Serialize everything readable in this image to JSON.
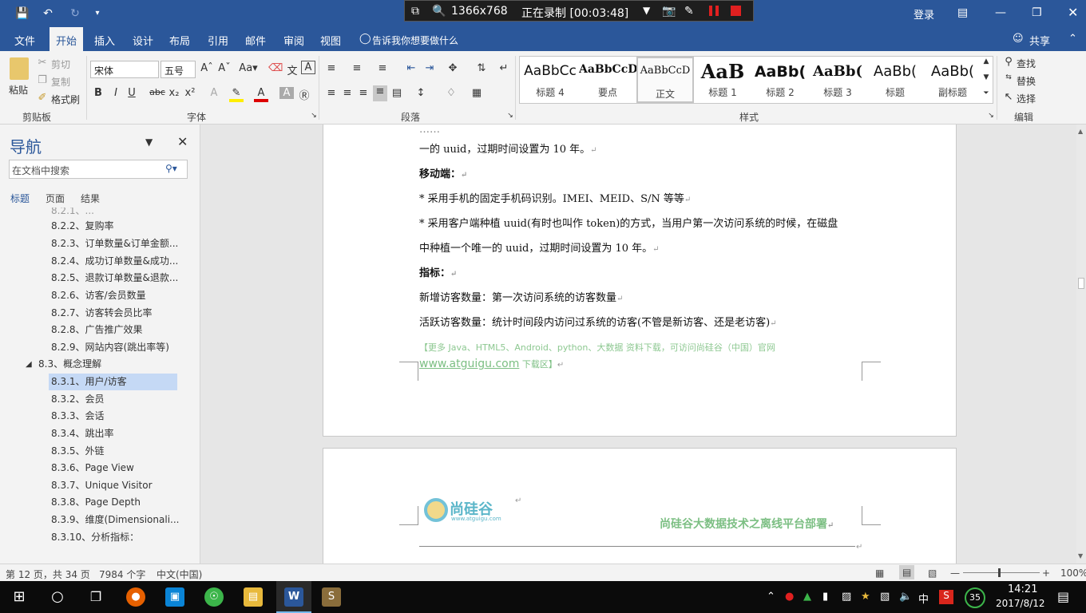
{
  "titlebar": {
    "recorder_size": "1366x768",
    "recorder_status": "正在录制 [00:03:48]",
    "login": "登录"
  },
  "ribbon_tabs": [
    "文件",
    "开始",
    "插入",
    "设计",
    "布局",
    "引用",
    "邮件",
    "审阅",
    "视图"
  ],
  "tell_me": "告诉我你想要做什么",
  "share": "共享",
  "clipboard": {
    "paste": "粘贴",
    "cut": "剪切",
    "copy": "复制",
    "format_painter": "格式刷",
    "label": "剪贴板"
  },
  "font": {
    "name": "宋体",
    "size": "五号",
    "label": "字体"
  },
  "paragraph": {
    "label": "段落"
  },
  "styles": {
    "label": "样式",
    "items": [
      {
        "preview": "AaBbCc",
        "name": "标题 4"
      },
      {
        "preview": "AaBbCcD",
        "name": "要点"
      },
      {
        "preview": "AaBbCcD",
        "name": "正文"
      },
      {
        "preview": "AaB",
        "name": "标题 1"
      },
      {
        "preview": "AaBb(",
        "name": "标题 2"
      },
      {
        "preview": "AaBb(",
        "name": "标题 3"
      },
      {
        "preview": "AaBb(",
        "name": "标题"
      },
      {
        "preview": "AaBb(",
        "name": "副标题"
      }
    ]
  },
  "editing": {
    "find": "查找",
    "replace": "替换",
    "select": "选择",
    "label": "编辑"
  },
  "nav": {
    "title": "导航",
    "search_placeholder": "在文档中搜索",
    "tabs": [
      "标题",
      "页面",
      "结果"
    ],
    "items": [
      "8.2.2、复购率",
      "8.2.3、订单数量&订单金额...",
      "8.2.4、成功订单数量&成功...",
      "8.2.5、退款订单数量&退款...",
      "8.2.6、访客/会员数量",
      "8.2.7、访客转会员比率",
      "8.2.8、广告推广效果",
      "8.2.9、网站内容(跳出率等)",
      "8.3、概念理解",
      "8.3.1、用户/访客",
      "8.3.2、会员",
      "8.3.3、会话",
      "8.3.4、跳出率",
      "8.3.5、外链",
      "8.3.6、Page View",
      "8.3.7、Unique Visitor",
      "8.3.8、Page Depth",
      "8.3.9、维度(Dimensionali...",
      "8.3.10、分析指标："
    ],
    "selected_index": 9
  },
  "doc": {
    "lines": [
      "一的 uuid，过期时间设置为 10 年。",
      "移动端：",
      "*  采用手机的固定手机码识别。IMEI、MEID、S/N 等等",
      "*  采用客户端种植  uuid(有时也叫作  token)的方式，当用户第一次访问系统的时候，在磁盘",
      "中种植一个唯一的 uuid，过期时间设置为 10 年。",
      "指标：",
      "新增访客数量：第一次访问系统的访客数量",
      "活跃访客数量：统计时间段内访问过系统的访客(不管是新访客、还是老访客)"
    ],
    "ad_line1": "【更多 Java、HTML5、Android、python、大数据 资料下载，可访问尚硅谷（中国）官网",
    "ad_url": "www.atguigu.com",
    "ad_tail": " 下载区】",
    "logo_text": "尚硅谷",
    "logo_sub": "www.atguigu.com",
    "header_title": "尚硅谷大数据技术之离线平台部署"
  },
  "status": {
    "page": "第 12 页，共 34 页",
    "words": "7984 个字",
    "lang": "中文(中国)",
    "zoom": "100%"
  },
  "taskbar": {
    "time": "14:21",
    "date": "2017/8/12",
    "ime": "中",
    "badge": "35"
  }
}
